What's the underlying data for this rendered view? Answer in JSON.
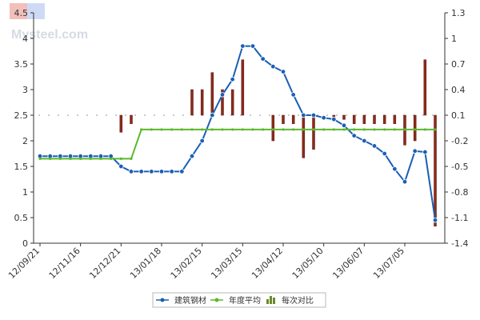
{
  "chart_data": {
    "type": "line",
    "title": "",
    "watermark": "Mysteel.com",
    "left_axis": {
      "min": 0,
      "max": 4.5,
      "ticks": [
        0,
        0.5,
        1,
        1.5,
        2,
        2.5,
        3,
        3.5,
        4,
        4.5
      ]
    },
    "right_axis": {
      "min": -1.4,
      "max": 1.3,
      "ticks": [
        -1.4,
        -1.1,
        -0.8,
        -0.5,
        -0.2,
        0.1,
        0.4,
        0.7,
        1,
        1.3
      ]
    },
    "x_tick_labels": [
      "12/09/21",
      "12/11/16",
      "12/12/21",
      "13/01/18",
      "13/02/15",
      "13/03/15",
      "13/04/12",
      "13/05/10",
      "13/06/07",
      "13/07/05"
    ],
    "x_tick_index": [
      0,
      4,
      8,
      12,
      16,
      20,
      24,
      28,
      32,
      36
    ],
    "series": [
      {
        "name": "建筑钢材",
        "color": "#1a5fb4",
        "axis": "left",
        "values": [
          1.7,
          1.7,
          1.7,
          1.7,
          1.7,
          1.7,
          1.7,
          1.7,
          1.5,
          1.4,
          1.4,
          1.4,
          1.4,
          1.4,
          1.4,
          1.7,
          2.0,
          2.5,
          2.9,
          3.2,
          3.85,
          3.85,
          3.6,
          3.45,
          3.35,
          2.9,
          2.5,
          2.5,
          2.45,
          2.42,
          2.3,
          2.1,
          2.0,
          1.9,
          1.75,
          1.45,
          1.2,
          1.8,
          1.78,
          0.45
        ]
      },
      {
        "name": "年度平均",
        "color": "#5cb82e",
        "axis": "left",
        "values": [
          1.65,
          1.65,
          1.65,
          1.65,
          1.65,
          1.65,
          1.65,
          1.65,
          1.65,
          1.65,
          2.22,
          2.22,
          2.22,
          2.22,
          2.22,
          2.22,
          2.22,
          2.22,
          2.22,
          2.22,
          2.22,
          2.22,
          2.22,
          2.22,
          2.22,
          2.22,
          2.22,
          2.22,
          2.22,
          2.22,
          2.22,
          2.22,
          2.22,
          2.22,
          2.22,
          2.22,
          2.22,
          2.22,
          2.22,
          2.22
        ]
      },
      {
        "name": "每次对比",
        "color": "#8b2a1a",
        "axis": "right",
        "type": "bar",
        "values": [
          0,
          0,
          0,
          0,
          0,
          0,
          0,
          0,
          -0.2,
          -0.1,
          0,
          0,
          0,
          0,
          0,
          0.3,
          0.3,
          0.5,
          0.3,
          0.3,
          0.65,
          0,
          0,
          -0.3,
          -0.1,
          -0.1,
          -0.5,
          -0.4,
          0,
          -0.05,
          -0.05,
          -0.1,
          -0.1,
          -0.1,
          -0.1,
          -0.1,
          -0.35,
          -0.3,
          0.65,
          -1.3
        ]
      }
    ],
    "legend": {
      "placement": "bottom-center",
      "items": [
        {
          "label": "建筑钢材",
          "color": "#1a5fb4",
          "kind": "line-dot"
        },
        {
          "label": "年度平均",
          "color": "#5cb82e",
          "kind": "line-dot"
        },
        {
          "label": "每次对比",
          "color": "#6a8a2a",
          "kind": "bars"
        }
      ]
    },
    "grid": false
  }
}
